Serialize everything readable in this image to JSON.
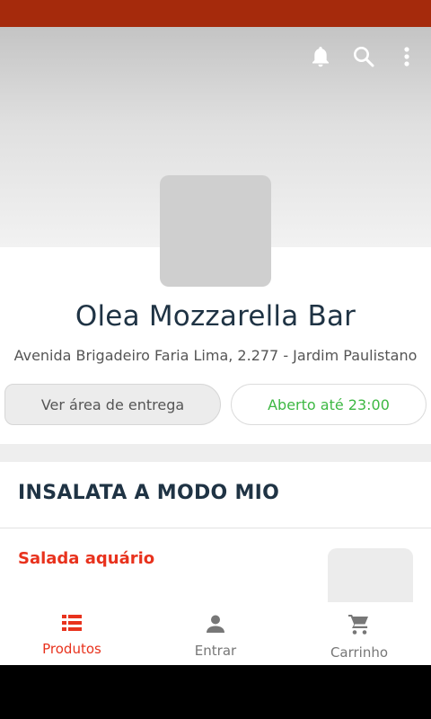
{
  "colors": {
    "status_bar": "#a52a0c",
    "brand_red": "#e8321d",
    "title_dark": "#1f3344",
    "open_green": "#3db843"
  },
  "header": {
    "actions": [
      {
        "icon": "bell-icon"
      },
      {
        "icon": "search-icon"
      },
      {
        "icon": "more-vertical-icon"
      }
    ]
  },
  "store": {
    "name": "Olea Mozzarella Bar",
    "address": "Avenida Brigadeiro Faria Lima, 2.277 - Jardim Paulistano",
    "delivery_area_label": "Ver área de entrega",
    "open_status": "Aberto até 23:00"
  },
  "menu": {
    "section_title": "INSALATA A MODO MIO",
    "products": [
      {
        "name": "Salada aquário"
      }
    ]
  },
  "bottom_nav": {
    "items": [
      {
        "label": "Produtos",
        "icon": "list-icon",
        "active": true
      },
      {
        "label": "Entrar",
        "icon": "person-icon",
        "active": false
      },
      {
        "label": "Carrinho",
        "icon": "cart-icon",
        "active": false
      }
    ]
  }
}
